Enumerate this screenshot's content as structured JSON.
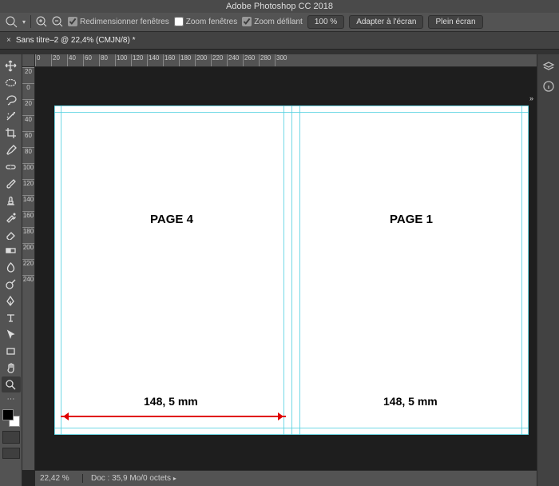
{
  "window": {
    "title": "Adobe Photoshop CC 2018"
  },
  "traffic": {
    "close": "#ff5f57",
    "min": "#febc2e",
    "max": "#28c840"
  },
  "options": {
    "resize_windows": "Redimensionner fenêtres",
    "zoom_windows": "Zoom fenêtres",
    "zoom_scroll": "Zoom défilant",
    "zoom_value": "100 %",
    "fit_screen": "Adapter à l'écran",
    "full_screen": "Plein écran"
  },
  "tab": {
    "label": "Sans titre–2 @ 22,4% (CMJN/8) *",
    "close": "×"
  },
  "ruler_h": [
    "0",
    "20",
    "40",
    "60",
    "80",
    "100",
    "120",
    "140",
    "160",
    "180",
    "200",
    "220",
    "240",
    "260",
    "280",
    "300"
  ],
  "ruler_v": [
    "20",
    "0",
    "20",
    "40",
    "60",
    "80",
    "100",
    "120",
    "140",
    "160",
    "180",
    "200",
    "220",
    "240"
  ],
  "canvas": {
    "page4": "PAGE 4",
    "page1": "PAGE 1",
    "measure_left": "148, 5 mm",
    "measure_right": "148, 5 mm"
  },
  "status": {
    "zoom": "22,42 %",
    "doc": "Doc : 35,9 Mo/0 octets"
  },
  "tools": [
    "move",
    "marquee-ellipse",
    "lasso",
    "magic-wand",
    "crop",
    "eyedropper",
    "healing",
    "brush",
    "stamp",
    "history-brush",
    "eraser",
    "gradient",
    "blur",
    "dodge",
    "pen",
    "type",
    "path-select",
    "rectangle",
    "hand",
    "zoom"
  ],
  "right": [
    "layers",
    "info"
  ]
}
